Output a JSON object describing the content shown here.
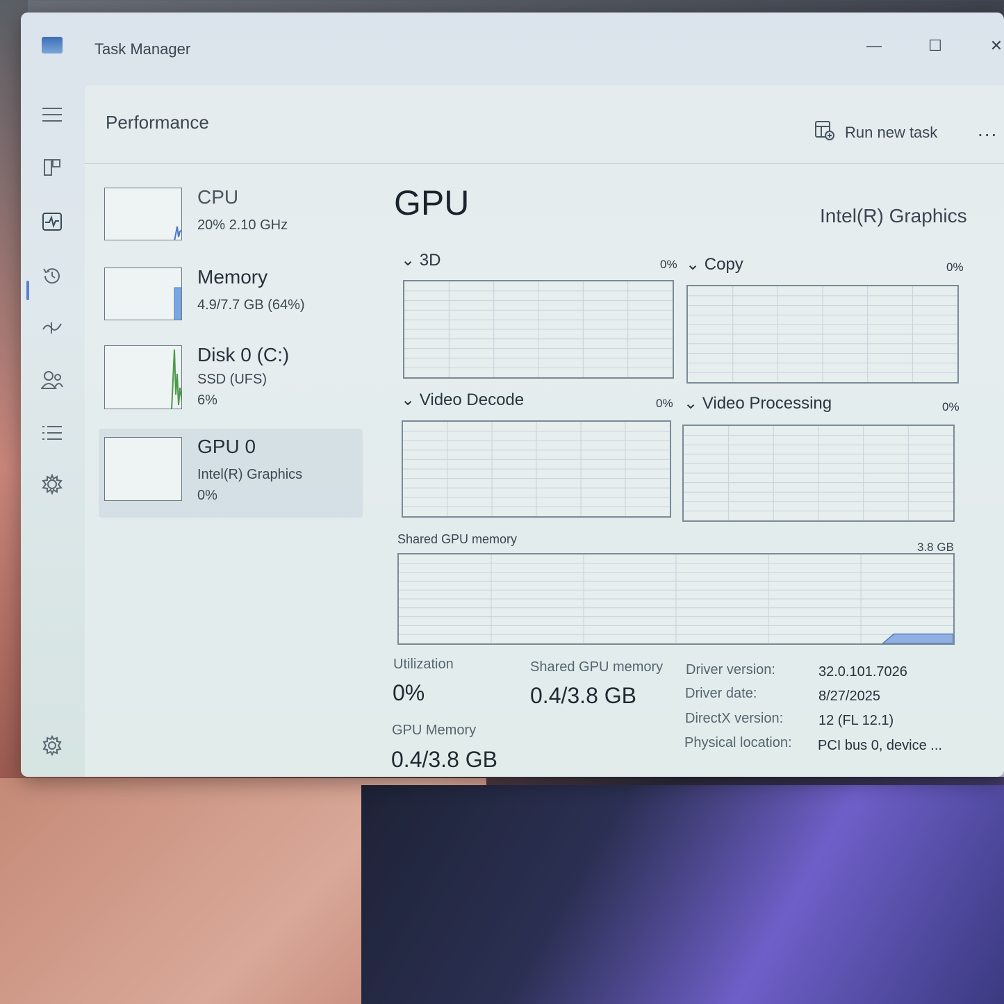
{
  "window": {
    "title": "Task Manager",
    "minimize": "—",
    "maximize": "☐",
    "close": "✕"
  },
  "header": {
    "title": "Performance",
    "run_new_task": "Run new task",
    "more": "..."
  },
  "devices": [
    {
      "name": "CPU",
      "line1": "20%  2.10 GHz",
      "line2": ""
    },
    {
      "name": "Memory",
      "line1": "4.9/7.7 GB (64%)",
      "line2": ""
    },
    {
      "name": "Disk 0 (C:)",
      "line1": "SSD (UFS)",
      "line2": "6%"
    },
    {
      "name": "GPU 0",
      "line1": "Intel(R) Graphics",
      "line2": "0%"
    }
  ],
  "gpu": {
    "title": "GPU",
    "model": "Intel(R) Graphics",
    "engines": [
      {
        "label": "3D",
        "percent": "0%"
      },
      {
        "label": "Copy",
        "percent": "0%"
      },
      {
        "label": "Video Decode",
        "percent": "0%"
      },
      {
        "label": "Video Processing",
        "percent": "0%"
      }
    ],
    "shared_memory_graph": {
      "label": "Shared GPU memory",
      "max": "3.8 GB"
    },
    "stats": {
      "utilization_label": "Utilization",
      "utilization_value": "0%",
      "shared_label": "Shared GPU memory",
      "shared_value": "0.4/3.8 GB",
      "gpu_memory_label": "GPU Memory",
      "gpu_memory_value": "0.4/3.8 GB"
    },
    "properties": [
      {
        "label": "Driver version:",
        "value": "32.0.101.7026"
      },
      {
        "label": "Driver date:",
        "value": "8/27/2025"
      },
      {
        "label": "DirectX version:",
        "value": "12 (FL 12.1)"
      },
      {
        "label": "Physical location:",
        "value": "PCI bus 0, device ..."
      }
    ]
  },
  "colors": {
    "accent": "#5a7fd0",
    "graph_line": "#4a78c8",
    "disk_line": "#4a9a4a"
  }
}
